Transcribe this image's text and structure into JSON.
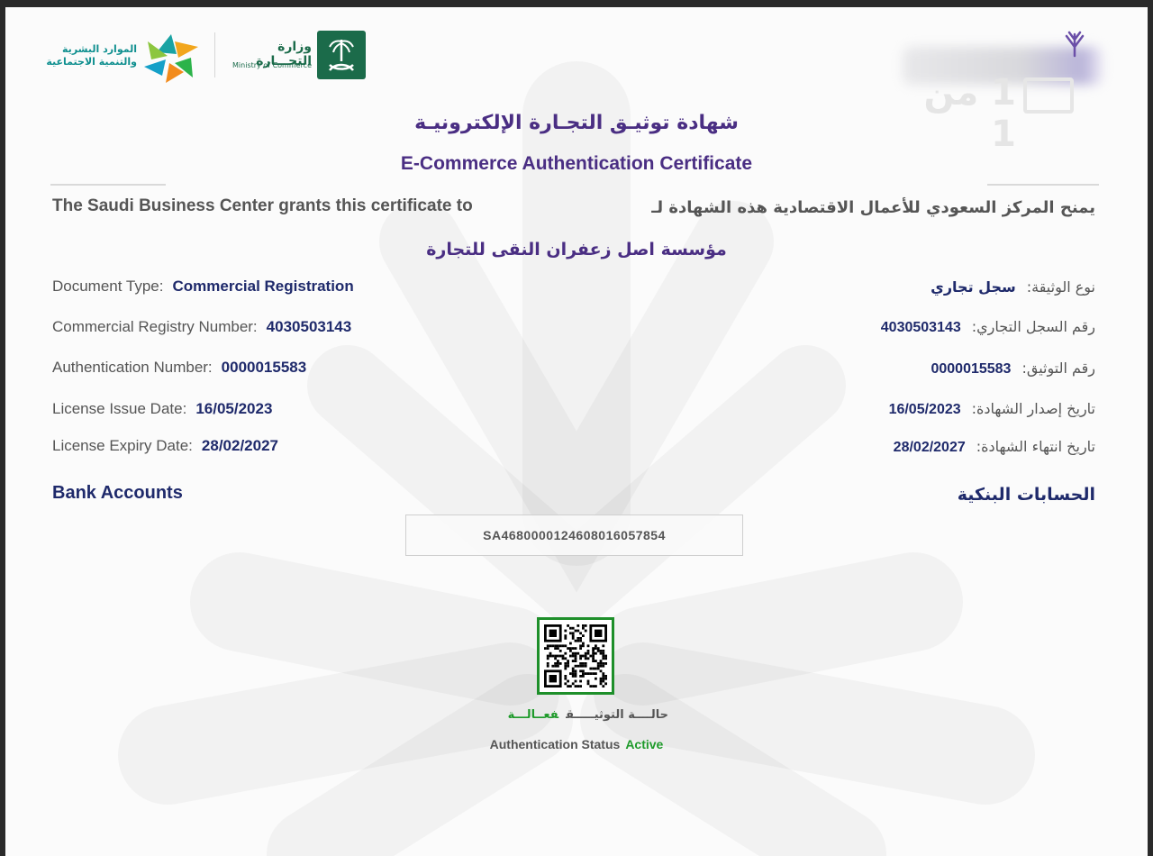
{
  "header": {
    "hrsd_logo_text": "الموارد البشرية والتنمية الاجتماعية",
    "moc_logo_text_ar": "وزارة التجـــارة",
    "moc_logo_text_en": "Ministry of Commerce",
    "page_indicator": "1 من 1"
  },
  "certificate": {
    "title_ar": "شهادة توثيـق التجـارة الإلكترونيـة",
    "title_en": "E-Commerce Authentication Certificate",
    "grant_en": "The Saudi Business Center grants this certificate to",
    "grant_ar": "يمنح المركز السعودي للأعمال الاقتصادية هذه الشهادة لـ",
    "company_name": "مؤسسة اصل زعفران النقى للتجارة"
  },
  "details_en": [
    {
      "label": "Document Type:",
      "value": "Commercial Registration"
    },
    {
      "label": "Commercial Registry Number:",
      "value": "4030503143"
    },
    {
      "label": "Authentication Number:",
      "value": "0000015583"
    },
    {
      "label": "License Issue Date:",
      "value": "16/05/2023"
    },
    {
      "label": "License Expiry Date:",
      "value": "28/02/2027"
    }
  ],
  "details_ar": [
    {
      "label": "نوع الوثيقة:",
      "value": "سجل تجاري"
    },
    {
      "label": "رقم السجل التجاري:",
      "value": "4030503143"
    },
    {
      "label": "رقم التوثيق:",
      "value": "0000015583"
    },
    {
      "label": "تاريخ إصدار الشهادة:",
      "value": "16/05/2023"
    },
    {
      "label": "تاريخ انتهاء الشهادة:",
      "value": "28/02/2027"
    }
  ],
  "bank": {
    "title_en": "Bank Accounts",
    "title_ar": "الحسابات البنكية",
    "iban": "SA4680000124608016057854"
  },
  "status": {
    "label_ar": "حالــــة التوثيـــــق",
    "value_ar": "فعــالـــة",
    "label_en": "Authentication Status",
    "value_en": "Active"
  },
  "colors": {
    "title_purple": "#4a2e83",
    "value_navy": "#1f2a6b",
    "active_green": "#1e9a2a",
    "moc_green": "#1b6b4a"
  }
}
